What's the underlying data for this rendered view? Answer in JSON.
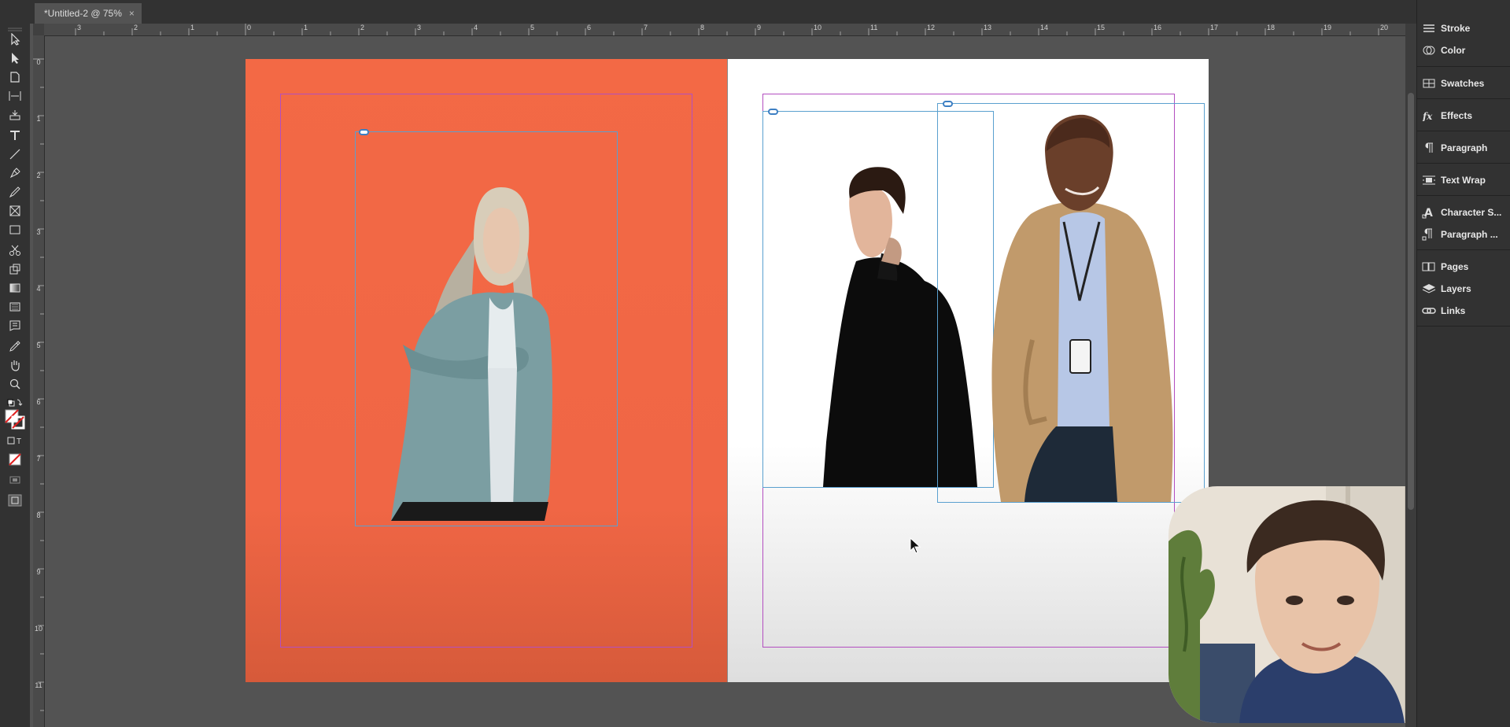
{
  "document": {
    "tab_title": "*Untitled-2 @ 75%",
    "close_glyph": "×"
  },
  "ruler": {
    "horizontal_labels": [
      "3",
      "2",
      "1",
      "0",
      "1",
      "2",
      "3",
      "4",
      "5",
      "6",
      "7",
      "8",
      "9",
      "10",
      "11",
      "12",
      "13",
      "14",
      "15",
      "16",
      "17",
      "18",
      "19",
      "20"
    ],
    "vertical_labels": [
      "0",
      "1",
      "2",
      "3",
      "4",
      "5",
      "6",
      "7",
      "8",
      "9",
      "10",
      "11"
    ]
  },
  "tools": [
    {
      "name": "selection-tool"
    },
    {
      "name": "direct-selection-tool"
    },
    {
      "name": "page-tool"
    },
    {
      "name": "gap-tool"
    },
    {
      "name": "content-collector-tool"
    },
    {
      "name": "type-tool"
    },
    {
      "name": "line-tool"
    },
    {
      "name": "pen-tool"
    },
    {
      "name": "pencil-tool"
    },
    {
      "name": "rectangle-frame-tool"
    },
    {
      "name": "rectangle-tool"
    },
    {
      "name": "scissors-tool"
    },
    {
      "name": "free-transform-tool"
    },
    {
      "name": "gradient-swatch-tool"
    },
    {
      "name": "gradient-feather-tool"
    },
    {
      "name": "note-tool"
    },
    {
      "name": "eyedropper-tool"
    },
    {
      "name": "hand-tool"
    },
    {
      "name": "zoom-tool"
    }
  ],
  "panels": [
    {
      "label": "Stroke",
      "icon": "stroke-icon"
    },
    {
      "label": "Color",
      "icon": "color-icon"
    },
    {
      "label": "Swatches",
      "icon": "swatches-icon"
    },
    {
      "label": "Effects",
      "icon": "effects-icon"
    },
    {
      "label": "Paragraph",
      "icon": "paragraph-icon"
    },
    {
      "label": "Text Wrap",
      "icon": "text-wrap-icon"
    },
    {
      "label": "Character S...",
      "icon": "character-styles-icon"
    },
    {
      "label": "Paragraph ...",
      "icon": "paragraph-styles-icon"
    },
    {
      "label": "Pages",
      "icon": "pages-icon"
    },
    {
      "label": "Layers",
      "icon": "layers-icon"
    },
    {
      "label": "Links",
      "icon": "links-icon"
    }
  ],
  "colors": {
    "left_page": "#f36945",
    "margin_guide": "#b34ec0",
    "frame_edge": "#5aa0cf",
    "link_badge": "#3d7fc3"
  }
}
